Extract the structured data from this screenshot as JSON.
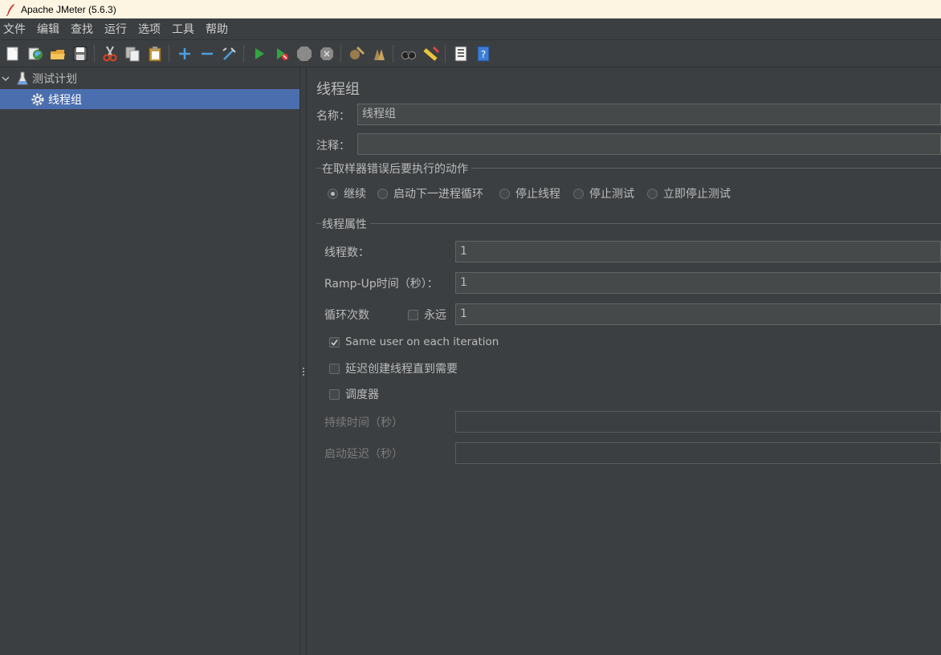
{
  "window": {
    "title": "Apache JMeter (5.6.3)"
  },
  "menu": [
    "文件",
    "编辑",
    "查找",
    "运行",
    "选项",
    "工具",
    "帮助"
  ],
  "toolbar": {
    "icons": [
      "new-icon",
      "templates-icon",
      "open-icon",
      "save-icon",
      "cut-icon",
      "copy-icon",
      "paste-icon",
      "expand-icon",
      "collapse-icon",
      "toggle-icon",
      "start-icon",
      "start-no-pause-icon",
      "stop-icon",
      "shutdown-icon",
      "clear-icon",
      "clear-all-icon",
      "search-icon",
      "reset-search-icon",
      "function-helper-icon",
      "help-icon"
    ]
  },
  "tree": {
    "root": {
      "label": "测试计划",
      "icon": "flask-icon"
    },
    "child": {
      "label": "线程组",
      "icon": "gear-icon",
      "selected": true
    }
  },
  "thread_group": {
    "title": "线程组",
    "name_label": "名称：",
    "name_value": "线程组",
    "comment_label": "注释：",
    "comment_value": "",
    "on_error": {
      "title": "在取样器错误后要执行的动作",
      "options": [
        "继续",
        "启动下一进程循环",
        "停止线程",
        "停止测试",
        "立即停止测试"
      ],
      "selected_index": 0
    },
    "props": {
      "title": "线程属性",
      "threads_label": "线程数：",
      "threads_value": "1",
      "rampup_label": "Ramp-Up时间（秒）：",
      "rampup_value": "1",
      "loop_label": "循环次数",
      "forever_label": "永远",
      "forever_checked": false,
      "loop_value": "1",
      "same_user_label": "Same user on each iteration",
      "same_user_checked": true,
      "delay_label": "延迟创建线程直到需要",
      "delay_checked": false,
      "scheduler_label": "调度器",
      "scheduler_checked": false,
      "duration_label": "持续时间（秒）",
      "duration_value": "",
      "startup_delay_label": "启动延迟（秒）",
      "startup_delay_value": ""
    }
  },
  "colors": {
    "background": "#3c3f41",
    "selection": "#4b6eaf",
    "titlebar": "#fdf5e2"
  }
}
